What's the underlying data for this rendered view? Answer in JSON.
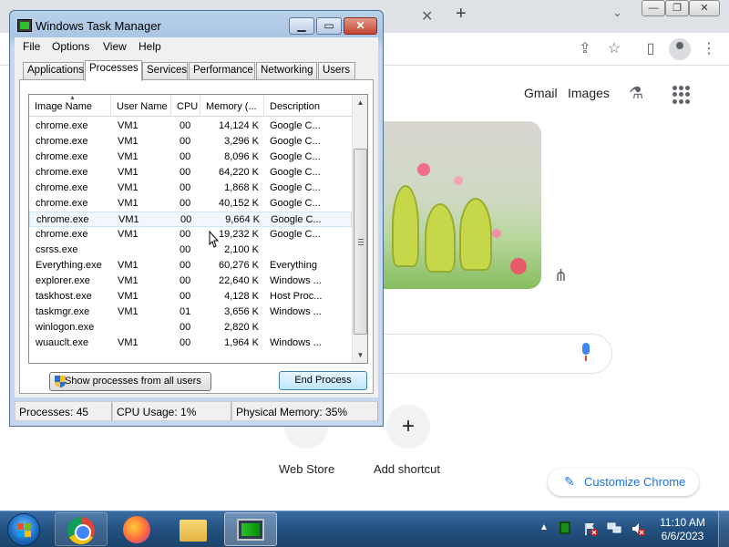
{
  "chrome": {
    "new_tab_glyph": "+",
    "close_tab_glyph": "✕",
    "header_links": [
      "Gmail",
      "Images"
    ],
    "shortcuts": [
      {
        "label": "Web Store"
      },
      {
        "label": "Add shortcut",
        "glyph": "+"
      }
    ],
    "customize_label": "Customize Chrome",
    "accent_color": "#1a73e8"
  },
  "task_manager": {
    "title": "Windows Task Manager",
    "menu": [
      "File",
      "Options",
      "View",
      "Help"
    ],
    "tabs": [
      "Applications",
      "Processes",
      "Services",
      "Performance",
      "Networking",
      "Users"
    ],
    "active_tab": "Processes",
    "columns": [
      "Image Name",
      "User Name",
      "CPU",
      "Memory (...",
      "Description"
    ],
    "sorted_column": "Image Name",
    "selected_row": 6,
    "processes": [
      {
        "name": "chrome.exe",
        "user": "VM1",
        "cpu": "00",
        "memory": "14,124 K",
        "description": "Google C..."
      },
      {
        "name": "chrome.exe",
        "user": "VM1",
        "cpu": "00",
        "memory": "3,296 K",
        "description": "Google C..."
      },
      {
        "name": "chrome.exe",
        "user": "VM1",
        "cpu": "00",
        "memory": "8,096 K",
        "description": "Google C..."
      },
      {
        "name": "chrome.exe",
        "user": "VM1",
        "cpu": "00",
        "memory": "64,220 K",
        "description": "Google C..."
      },
      {
        "name": "chrome.exe",
        "user": "VM1",
        "cpu": "00",
        "memory": "1,868 K",
        "description": "Google C..."
      },
      {
        "name": "chrome.exe",
        "user": "VM1",
        "cpu": "00",
        "memory": "40,152 K",
        "description": "Google C..."
      },
      {
        "name": "chrome.exe",
        "user": "VM1",
        "cpu": "00",
        "memory": "9,664 K",
        "description": "Google C..."
      },
      {
        "name": "chrome.exe",
        "user": "VM1",
        "cpu": "00",
        "memory": "19,232 K",
        "description": "Google C..."
      },
      {
        "name": "csrss.exe",
        "user": "",
        "cpu": "00",
        "memory": "2,100 K",
        "description": ""
      },
      {
        "name": "Everything.exe",
        "user": "VM1",
        "cpu": "00",
        "memory": "60,276 K",
        "description": "Everything"
      },
      {
        "name": "explorer.exe",
        "user": "VM1",
        "cpu": "00",
        "memory": "22,640 K",
        "description": "Windows ..."
      },
      {
        "name": "taskhost.exe",
        "user": "VM1",
        "cpu": "00",
        "memory": "4,128 K",
        "description": "Host Proc..."
      },
      {
        "name": "taskmgr.exe",
        "user": "VM1",
        "cpu": "01",
        "memory": "3,656 K",
        "description": "Windows ..."
      },
      {
        "name": "winlogon.exe",
        "user": "",
        "cpu": "00",
        "memory": "2,820 K",
        "description": ""
      },
      {
        "name": "wuauclt.exe",
        "user": "VM1",
        "cpu": "00",
        "memory": "1,964 K",
        "description": "Windows ..."
      }
    ],
    "buttons": {
      "show_all": "Show processes from all users",
      "end_process": "End Process"
    },
    "status": {
      "processes": "Processes: 45",
      "cpu": "CPU Usage: 1%",
      "memory": "Physical Memory: 35%"
    }
  },
  "taskbar": {
    "pinned": [
      "chrome-icon",
      "firefox-icon",
      "folder-icon",
      "task-manager-icon"
    ],
    "clock_time": "11:10 AM",
    "clock_date": "6/6/2023"
  }
}
